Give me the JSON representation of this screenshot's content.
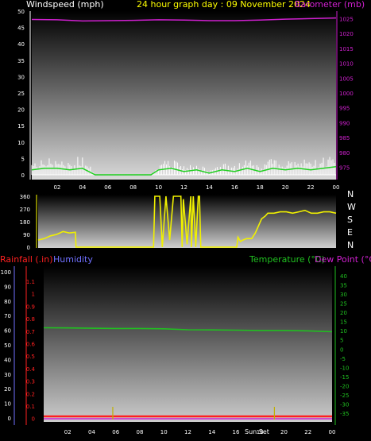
{
  "colors": {
    "windspeed": "#ffffff",
    "gust": "#dcdcdc",
    "wind_avg": "#20d020",
    "barometer": "#d020d0",
    "direction": "#f0f000",
    "rainfall": "#ff2020",
    "humidity": "#7070ff",
    "temperature": "#20c020",
    "dewpoint": "#d020d0",
    "sun_marker": "#c0b000"
  },
  "header": {
    "windspeed_label": "Windspeed (mph)",
    "title": "24 hour graph day : 09 November 2024",
    "barometer_label": "Barometer (mb)"
  },
  "bottom_header": {
    "rainfall_label": "Rainfall (.in)",
    "humidity_label": "Humidity",
    "temperature_label": "Temperature (°C)",
    "dewpoint_label": "Dew Point (°C)"
  },
  "direction_side_labels": [
    "N",
    "W",
    "S",
    "E",
    "N"
  ],
  "sun_labels": [
    "Sun Set",
    "Sun Set"
  ],
  "chart_data": [
    {
      "type": "line",
      "name": "wind-barometer",
      "x_ticks": [
        "02",
        "04",
        "06",
        "08",
        "10",
        "12",
        "14",
        "16",
        "18",
        "20",
        "22",
        "00"
      ],
      "y_left_ticks": [
        "50",
        "45",
        "40",
        "35",
        "30",
        "25",
        "20",
        "15",
        "10",
        "5",
        "0"
      ],
      "y_right_ticks": [
        "1025",
        "1020",
        "1015",
        "1010",
        "1005",
        "1000",
        "995",
        "990",
        "985",
        "980",
        "975"
      ],
      "ylim_left": [
        0,
        50
      ],
      "ylim_right": [
        972.5,
        1027.5
      ],
      "series": [
        {
          "name": "Windspeed (mph)",
          "x": [
            0,
            1,
            2,
            3,
            4,
            5,
            9.4,
            10,
            11,
            12,
            13,
            14,
            15,
            16,
            17,
            18,
            19,
            20,
            21,
            22,
            23,
            24
          ],
          "y": [
            3,
            4,
            4,
            3,
            5,
            0,
            0,
            3,
            4,
            2,
            3,
            1,
            3,
            2,
            4,
            2,
            4,
            3,
            4,
            3,
            4,
            6
          ]
        },
        {
          "name": "Wind average",
          "x": [
            0,
            1,
            2,
            3,
            4,
            5,
            9.4,
            10,
            11,
            12,
            13,
            14,
            15,
            16,
            17,
            18,
            19,
            20,
            21,
            22,
            23,
            24
          ],
          "y": [
            1.5,
            2,
            2,
            1.5,
            2,
            0,
            0,
            1.5,
            2,
            1,
            1.5,
            0.5,
            1.5,
            1,
            2,
            1,
            2,
            1.5,
            2,
            1.5,
            2,
            2.5
          ]
        },
        {
          "name": "Barometer (mb)",
          "x": [
            0,
            2,
            4,
            6,
            8,
            10,
            12,
            14,
            16,
            18,
            20,
            22,
            24
          ],
          "y": [
            1024.7,
            1024.6,
            1024.2,
            1024.3,
            1024.4,
            1024.6,
            1024.5,
            1024.3,
            1024.3,
            1024.5,
            1024.8,
            1025.0,
            1025.2
          ]
        }
      ]
    },
    {
      "type": "line",
      "name": "wind-direction",
      "y_ticks": [
        "360",
        "270",
        "180",
        "90",
        "0"
      ],
      "ylim": [
        0,
        360
      ],
      "series": [
        {
          "name": "Wind direction",
          "x": [
            0,
            0.5,
            1,
            1.5,
            2,
            2.5,
            3,
            3.05,
            9.3,
            9.4,
            9.8,
            10,
            10.3,
            10.6,
            10.9,
            11,
            11.1,
            11.5,
            11.6,
            11.7,
            12,
            12.3,
            12.35,
            12.5,
            12.7,
            12.9,
            13,
            13.1,
            16,
            16.1,
            16.3,
            16.5,
            16.8,
            17.2,
            17.5,
            18,
            18.3,
            18.5,
            19,
            19.5,
            20,
            20.5,
            21,
            21.5,
            22,
            22.5,
            23,
            23.5,
            24
          ],
          "y": [
            50,
            60,
            80,
            90,
            110,
            100,
            105,
            0,
            0,
            360,
            360,
            0,
            360,
            50,
            360,
            360,
            360,
            360,
            0,
            340,
            20,
            360,
            0,
            360,
            0,
            360,
            360,
            0,
            0,
            70,
            40,
            50,
            60,
            60,
            100,
            200,
            220,
            240,
            240,
            250,
            250,
            240,
            250,
            260,
            240,
            240,
            250,
            250,
            240
          ]
        }
      ]
    },
    {
      "type": "line",
      "name": "temperature-humidity-rain",
      "x_ticks": [
        "02",
        "04",
        "06",
        "08",
        "10",
        "12",
        "14",
        "16",
        "18",
        "20",
        "22",
        "00"
      ],
      "y_humidity_ticks": [
        "100",
        "90",
        "80",
        "70",
        "60",
        "50",
        "40",
        "30",
        "20",
        "10",
        "0"
      ],
      "y_rain_ticks": [
        "1.1",
        "1",
        "0.9",
        "0.8",
        "0.7",
        "0.6",
        "0.5",
        "0.4",
        "0.3",
        "0.2",
        "0.1",
        "0"
      ],
      "y_temp_ticks": [
        "40",
        "35",
        "30",
        "25",
        "20",
        "15",
        "10",
        "5",
        "0",
        "-5",
        "-10",
        "-15",
        "-20",
        "-25",
        "-30",
        "-35"
      ],
      "ylim_temp": [
        -37.5,
        42.5
      ],
      "series": [
        {
          "name": "Temperature (°C)",
          "x": [
            0,
            2,
            4,
            6,
            8,
            10,
            12,
            14,
            16,
            18,
            20,
            22,
            24
          ],
          "y": [
            11.6,
            11.5,
            11.3,
            11.2,
            11.2,
            11.0,
            10.5,
            10.4,
            10.3,
            10.1,
            10.1,
            9.9,
            9.4
          ]
        },
        {
          "name": "Rainfall (.in)",
          "x": [
            0,
            24
          ],
          "y": [
            0,
            0
          ]
        }
      ],
      "sun_marker_hours": [
        5.75,
        19.2
      ]
    }
  ]
}
